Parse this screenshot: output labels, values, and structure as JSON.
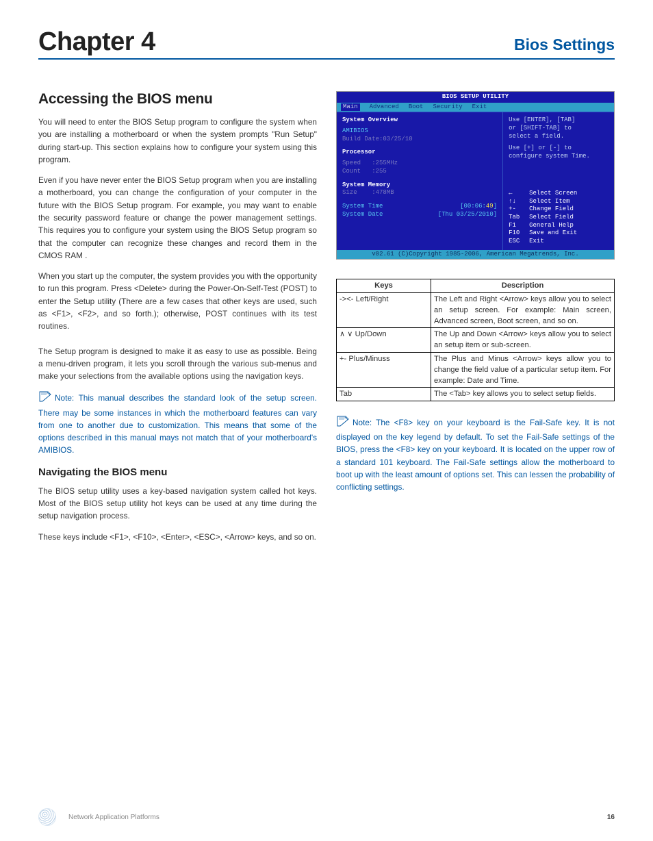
{
  "header": {
    "chapter": "Chapter 4",
    "right": "Bios Settings"
  },
  "left": {
    "h2": "Accessing the BIOS menu",
    "p1": "You will need to enter the BIOS Setup program to configure the system when you are installing a motherboard or when the system prompts \"Run Setup\" during start-up. This section explains how to configure your system using this program.",
    "p2": "Even if you have never enter the BIOS Setup program when you are installing a motherboard, you can change the configuration of your computer in the future with the BIOS Setup program. For example, you may want to enable the security password feature or change the power management settings. This requires you to configure your system using the BIOS Setup program so that the computer can recognize these changes and record them in the CMOS RAM .",
    "p3": "When you start up the computer, the system provides you with the opportunity to run this program. Press <Delete> during the Power-On-Self-Test (POST) to enter the Setup utility (There are a few cases that other keys are used, such as <F1>, <F2>, and so forth.); otherwise, POST continues with its test routines.",
    "p4": "The Setup program is designed to make it as easy to use as possible. Being a menu-driven program, it lets you scroll through the various sub-menus and make your selections from the available options using the navigation keys.",
    "note1": "Note:  This manual describes the standard look of the setup screen. There may be some instances in which the  motherboard features can vary from one to another due to customization. This means that some of the options described in this manual mays not match that of your motherboard's AMIBIOS.",
    "h3": "Navigating the BIOS menu",
    "p5": "The BIOS setup utility uses a key-based navigation system called hot keys. Most of the BIOS setup utility hot keys can be used at any time during the setup navigation process.",
    "p6": "These keys include <F1>, <F10>, <Enter>, <ESC>, <Arrow> keys, and so on."
  },
  "bios": {
    "title": "BIOS SETUP UTILITY",
    "tabs": {
      "main": "Main",
      "advanced": "Advanced",
      "boot": "Boot",
      "security": "Security",
      "exit": "Exit"
    },
    "overview": "System Overview",
    "amibios": "AMIBIOS",
    "build": "Build Date:03/25/10",
    "processor": "Processor",
    "speedlbl": "Speed",
    "speedval": ":255MHz",
    "countlbl": "Count",
    "countval": ":255",
    "memory": "System Memory",
    "sizelbl": "Size",
    "sizeval": ":478MB",
    "systime": "System Time",
    "systimeval_a": "[00:06:",
    "systimeval_b": "49",
    "systimeval_c": "]",
    "sysdate": "System Date",
    "sysdateval": "[Thu 03/25/2010]",
    "hint1": "Use [ENTER], [TAB]",
    "hint2": "or [SHIFT-TAB] to",
    "hint3": "select a field.",
    "hint4": "Use [+] or [-] to",
    "hint5": "configure system Time.",
    "nav_screen_k": "←",
    "nav_screen": "Select Screen",
    "nav_item_k": "↑↓",
    "nav_item": "Select Item",
    "nav_change_k": "+-",
    "nav_change": "Change Field",
    "nav_field_k": "Tab",
    "nav_field": "Select Field",
    "nav_help_k": "F1",
    "nav_help": "General Help",
    "nav_save_k": "F10",
    "nav_save": "Save and Exit",
    "nav_exit_k": "ESC",
    "nav_exit": "Exit",
    "footer": "v02.61 (C)Copyright 1985-2006, American Megatrends, Inc."
  },
  "table": {
    "h_keys": "Keys",
    "h_desc": "Description",
    "rows": [
      {
        "k": "-><- Left/Right",
        "d": "The Left and Right <Arrow> keys allow you to select an setup screen. For example: Main screen, Advanced screen, Boot screen, and so on."
      },
      {
        "k": "∧ ∨ Up/Down",
        "d": "The Up and Down <Arrow> keys allow you to select an setup item or sub-screen."
      },
      {
        "k": "+- Plus/Minuss",
        "d": "The Plus and Minus <Arrow> keys allow you to change the field value of a particular setup item. For example: Date and Time."
      },
      {
        "k": "Tab",
        "d": "The <Tab> key allows you to select setup fields."
      }
    ]
  },
  "note2": "Note:  The <F8> key on your keyboard is the Fail-Safe key. It is not displayed on the key legend by default. To set the Fail-Safe settings of the BIOS, press the <F8> key on your keyboard. It is located on the upper row of a standard 101 keyboard. The Fail-Safe settings allow the motherboard to boot up with the least amount of options set. This can lessen the probability of conflicting settings.",
  "footer": {
    "text": "Network Application Platforms",
    "page": "16"
  }
}
